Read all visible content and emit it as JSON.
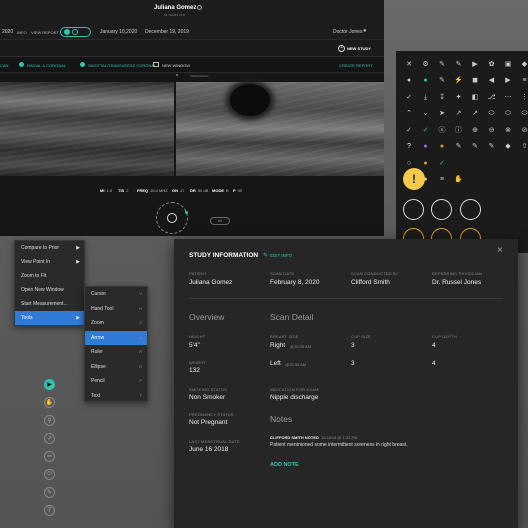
{
  "header": {
    "patient_name": "Juliana Gomez",
    "patient_sub": "62 YEARS OLD",
    "date_left": "2020",
    "info_label": "INFO",
    "view_report": "VIEW REPORT",
    "date_mid": "January 10,2020",
    "date_right": "December 19, 2019",
    "doctor": "Doctor Jones",
    "new_study": "NEW STUDY"
  },
  "views": {
    "tab1": "CAN",
    "tab2": "RADIAL & CORONAL",
    "tab3": "SAGITTAL/TRANSVERSE CORONAL",
    "new_window": "NEW WINDOW",
    "create_report": "CREATE REPORT",
    "panel_label": "PERIPHERAL"
  },
  "params": [
    {
      "k": "MI",
      "v": "1.5"
    },
    {
      "k": "TIS",
      "v": "2"
    },
    {
      "k": "FREQ",
      "v": "16.0 MHZ"
    },
    {
      "k": "GN",
      "v": "47"
    },
    {
      "k": "DR",
      "v": "50 dB"
    },
    {
      "k": "MODE",
      "v": "B"
    },
    {
      "k": "P",
      "v": "90"
    }
  ],
  "dial_button": "x1",
  "context_menu": {
    "items": [
      {
        "label": "Compare to Prior",
        "arrow": "▶"
      },
      {
        "label": "View Point In",
        "arrow": "▶"
      },
      {
        "label": "Zoom to Fit",
        "arrow": ""
      },
      {
        "label": "Open New Window",
        "arrow": ""
      },
      {
        "label": "Start Measurement...",
        "arrow": ""
      },
      {
        "label": "Tools",
        "arrow": "▶"
      }
    ]
  },
  "tools_menu": {
    "items": [
      {
        "label": "Cursor",
        "key": "V"
      },
      {
        "label": "Hand Tool",
        "key": "H"
      },
      {
        "label": "Zoom",
        "key": "Z"
      },
      {
        "label": "Arrow",
        "key": "A"
      },
      {
        "label": "Ruler",
        "key": "R"
      },
      {
        "label": "Ellipse",
        "key": "O"
      },
      {
        "label": "Pencil",
        "key": "P"
      },
      {
        "label": "Text",
        "key": "T"
      }
    ]
  },
  "study": {
    "title": "STUDY INFORMATION",
    "edit": "EDIT INFO",
    "patient_label": "PATIENT",
    "patient": "Juliana Gomez",
    "scan_date_label": "SCAN DATE",
    "scan_date": "February 8, 2020",
    "conducted_label": "SCAN CONDUCTED BY",
    "conducted": "Clifford Smith",
    "referring_label": "REFERRING PHYSICIAN",
    "referring": "Dr. Russel Jones",
    "overview": "Overview",
    "height_label": "HEIGHT",
    "height": "5'4\"",
    "weight_label": "WEIGHT",
    "weight": "132",
    "smoking_label": "SMOKING STATUS",
    "smoking": "Non Smoker",
    "pregnancy_label": "PREGNANCY STATUS",
    "pregnancy": "Not Pregnant",
    "lmp_label": "LAST MENSTRUAL DATE",
    "lmp": "June 16 2018",
    "scan_detail": "Scan Detail",
    "breast_side_label": "BREAST SIDE",
    "cup_size_label": "CUP SIZE",
    "cup_depth_label": "CUP DEPTH",
    "row1_side": "Right",
    "row1_time": "@10:35 AM",
    "row1_cup": "3",
    "row1_depth": "4",
    "row2_side": "Left",
    "row2_time": "@10:35 AM",
    "row2_cup": "3",
    "row2_depth": "4",
    "indication_label": "INDICATION FOR EXAM",
    "indication": "Nipple discharge",
    "notes": "Notes",
    "note_author": "CLIFFORD SMITH NOTED",
    "note_time": "11/18/19 @ 1:32 PM",
    "note_text": "Patient mentnioned some intermittent soreness in right breast.",
    "add_note": "ADD NOTE"
  },
  "colors": {
    "accent": "#2ec4b0",
    "selected": "#2f7bd6",
    "warning": "#f2c94c"
  }
}
